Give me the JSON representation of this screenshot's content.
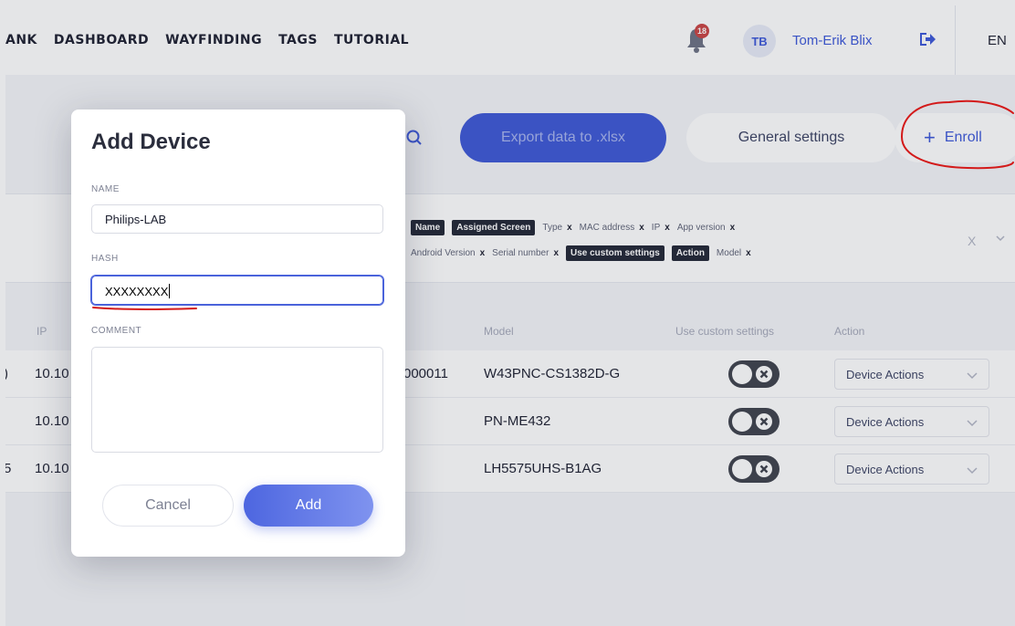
{
  "nav": {
    "links": [
      "ANK",
      "DASHBOARD",
      "WAYFINDING",
      "TAGS",
      "TUTORIAL"
    ],
    "notification_count": "18",
    "avatar_initials": "TB",
    "user_name": "Tom-Erik Blix",
    "language": "EN"
  },
  "toolbar": {
    "export_label": "Export data to .xlsx",
    "settings_label": "General settings",
    "enroll_label": "Enroll",
    "enroll_plus": "+"
  },
  "filters": {
    "row1": [
      {
        "label": "Name",
        "active": true
      },
      {
        "label": "Assigned Screen",
        "active": true
      },
      {
        "label": "Type",
        "active": false
      },
      {
        "label": "MAC address",
        "active": false
      },
      {
        "label": "IP",
        "active": false
      },
      {
        "label": "App version",
        "active": false
      }
    ],
    "row2": [
      {
        "label": "Android Version",
        "active": false
      },
      {
        "label": "Serial number",
        "active": false
      },
      {
        "label": "Use custom settings",
        "active": true
      },
      {
        "label": "Action",
        "active": true
      },
      {
        "label": "Model",
        "active": false
      }
    ],
    "remove_glyph": "x",
    "clear_glyph": "X"
  },
  "table": {
    "headers": {
      "ip": "IP",
      "model": "Model",
      "custom": "Use custom settings",
      "action": "Action"
    },
    "rows": [
      {
        "lead": ")",
        "ip": "10.10",
        "serial": "000011",
        "model": "W43PNC-CS1382D-G",
        "action": "Device Actions"
      },
      {
        "lead": "",
        "ip": "10.10",
        "serial": "",
        "model": "PN-ME432",
        "action": "Device Actions"
      },
      {
        "lead": "5",
        "ip": "10.10",
        "serial": "",
        "model": "LH5575UHS-B1AG",
        "action": "Device Actions"
      }
    ]
  },
  "modal": {
    "title": "Add Device",
    "name_label": "NAME",
    "name_value": "Philips-LAB",
    "hash_label": "HASH",
    "hash_value": "XXXXXXXX",
    "comment_label": "COMMENT",
    "comment_value": "",
    "cancel_label": "Cancel",
    "add_label": "Add"
  },
  "colors": {
    "primary": "#3b55d6",
    "annotation": "#d31a1a",
    "badge": "#c94141"
  }
}
